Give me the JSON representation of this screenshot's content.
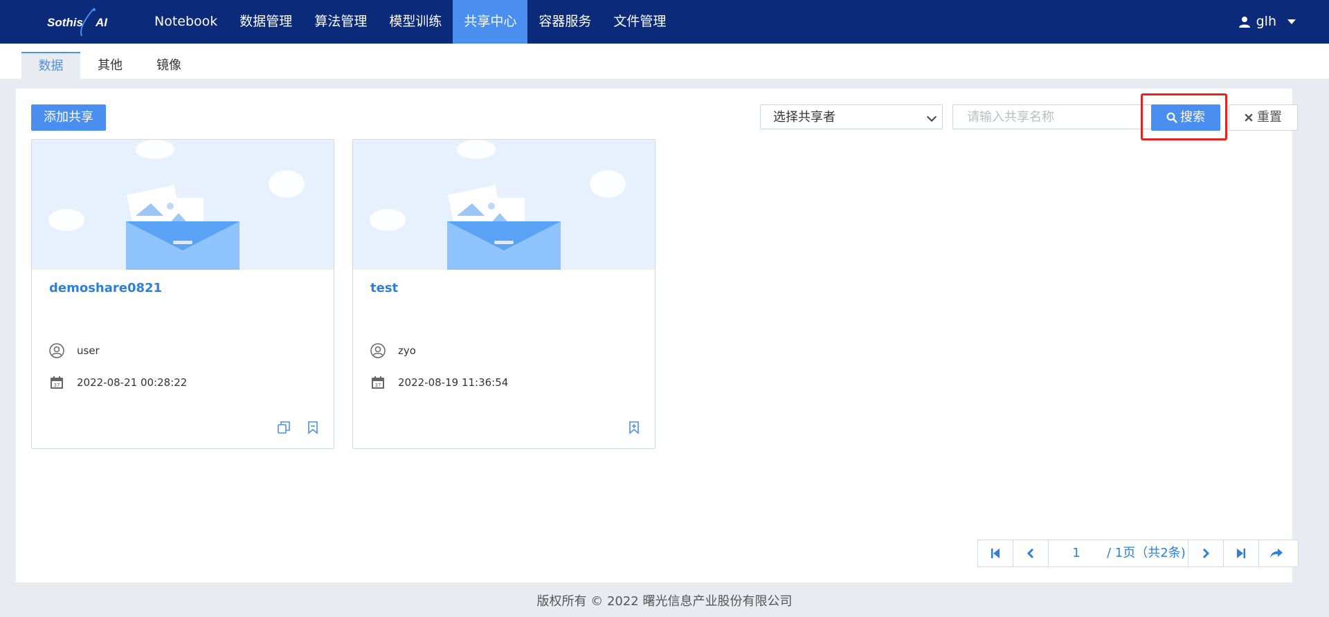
{
  "app": {
    "logo_text": "Sothis AI",
    "nav": [
      "Notebook",
      "数据管理",
      "算法管理",
      "模型训练",
      "共享中心",
      "容器服务",
      "文件管理"
    ],
    "active_nav": "共享中心",
    "user": "glh"
  },
  "subtabs": [
    "数据",
    "其他",
    "镜像"
  ],
  "active_subtab": "数据",
  "toolbar": {
    "add_label": "添加共享",
    "sharer_select": "选择共享者",
    "search_placeholder": "请输入共享名称",
    "search_label": "搜索",
    "reset_label": "重置"
  },
  "cards": [
    {
      "name": "demoshare0821",
      "user": "user",
      "time": "2022-08-21 00:28:22",
      "actions": [
        "copy-icon",
        "bookmark-remove-icon"
      ]
    },
    {
      "name": "test",
      "user": "zyo",
      "time": "2022-08-19 11:36:54",
      "actions": [
        "bookmark-add-icon"
      ]
    }
  ],
  "pagination": {
    "current_page": "1",
    "info": "/ 1页（共2条)"
  },
  "footer": "版权所有 © 2022 曙光信息产业股份有限公司",
  "colors": {
    "nav_bg": "#0b2a7a",
    "accent": "#4a8ff0",
    "highlight": "#e8231f"
  }
}
